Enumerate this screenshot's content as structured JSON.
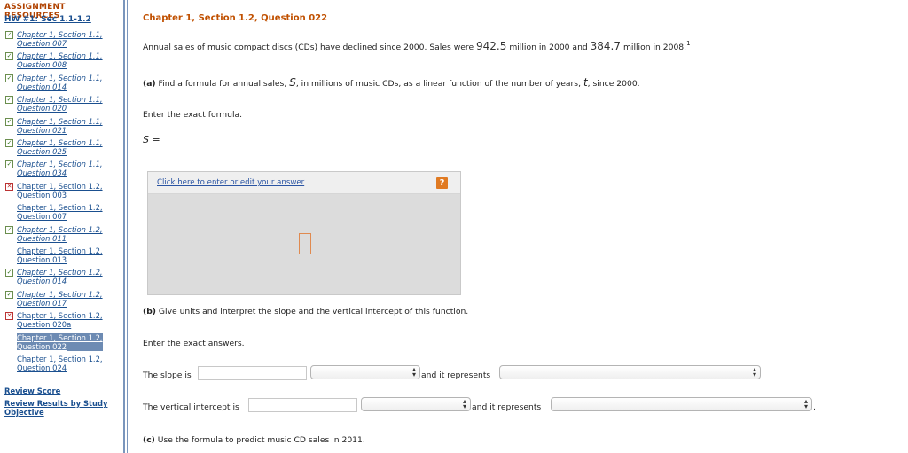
{
  "sidebar": {
    "title": "ASSIGNMENT RESOURCES",
    "hw_link": "HW #1: Sec 1.1-1.2",
    "items": [
      {
        "label": "Chapter 1, Section 1.1,\nQuestion 007",
        "status": "check",
        "italic": true
      },
      {
        "label": "Chapter 1, Section 1.1,\nQuestion 008",
        "status": "check",
        "italic": true
      },
      {
        "label": "Chapter 1, Section 1.1,\nQuestion 014",
        "status": "check",
        "italic": true
      },
      {
        "label": "Chapter 1, Section 1.1,\nQuestion 020",
        "status": "check",
        "italic": true
      },
      {
        "label": "Chapter 1, Section 1.1,\nQuestion 021",
        "status": "check",
        "italic": true
      },
      {
        "label": "Chapter 1, Section 1.1,\nQuestion 025",
        "status": "check",
        "italic": true
      },
      {
        "label": "Chapter 1, Section 1.1,\nQuestion 034",
        "status": "check",
        "italic": true
      },
      {
        "label": "Chapter 1, Section 1.2,\nQuestion 003",
        "status": "x",
        "italic": false
      },
      {
        "label": "Chapter 1, Section 1.2,\nQuestion 007",
        "status": "none",
        "italic": false
      },
      {
        "label": "Chapter 1, Section 1.2,\nQuestion 011",
        "status": "check",
        "italic": true
      },
      {
        "label": "Chapter 1, Section 1.2,\nQuestion 013",
        "status": "none",
        "italic": false
      },
      {
        "label": "Chapter 1, Section 1.2,\nQuestion 014",
        "status": "check",
        "italic": true
      },
      {
        "label": "Chapter 1, Section 1.2,\nQuestion 017",
        "status": "check",
        "italic": true
      },
      {
        "label": "Chapter 1, Section 1.2,\nQuestion 020a",
        "status": "x",
        "italic": false
      },
      {
        "label": "Chapter 1, Section 1.2,\nQuestion 022",
        "status": "selected",
        "italic": false
      },
      {
        "label": "Chapter 1, Section 1.2,\nQuestion 024",
        "status": "none",
        "italic": false
      }
    ],
    "review_score": "Review Score",
    "review_results": "Review Results by Study\nObjective"
  },
  "question": {
    "title": "Chapter 1, Section 1.2, Question 022",
    "intro_1": "Annual sales of music compact discs (CDs) have declined since 2000. Sales were",
    "value_2000": "942.5",
    "intro_2": "million in 2000 and",
    "value_2008": "384.7",
    "intro_3": "million in 2008.",
    "footnote": "1",
    "part_a_label": "(a)",
    "part_a_1": "Find a formula for annual sales,",
    "var_s": "S",
    "part_a_2": ", in millions of music CDs, as a linear function of the number of years,",
    "var_t": "t",
    "part_a_3": ", since 2000.",
    "enter_formula": "Enter the exact formula.",
    "s_equals": "S =",
    "answer_link": "Click here to enter or edit your answer",
    "help_icon": "?",
    "part_b_label": "(b)",
    "part_b_text": "Give units and interpret the slope and the vertical intercept of this function.",
    "enter_answers": "Enter the exact answers.",
    "slope_label": "The slope is",
    "slope_represents": "and it represents",
    "intercept_label": "The vertical intercept is",
    "intercept_represents": "and it represents",
    "period": ".",
    "part_c_label": "(c)",
    "part_c_text": "Use the formula to predict music CD sales in 2011."
  },
  "colors": {
    "title_orange": "#c05000",
    "link_blue": "#1a4f8f",
    "selected_bg": "#6d8bb3"
  }
}
